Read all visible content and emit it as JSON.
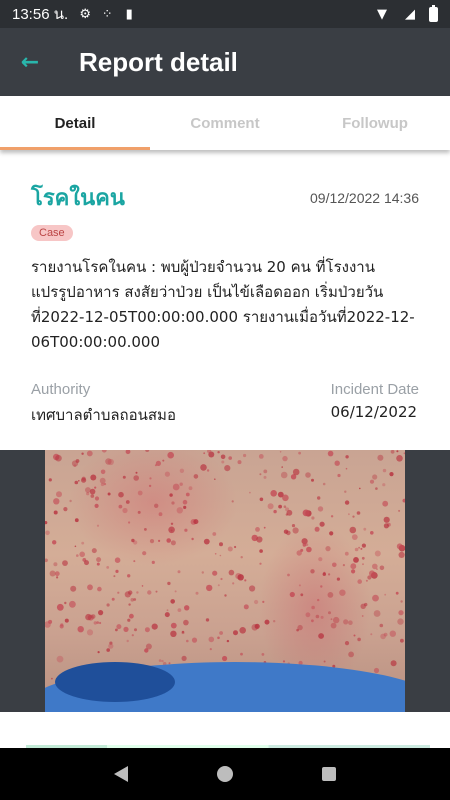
{
  "status_bar": {
    "time": "13:56 น."
  },
  "app_bar": {
    "back_icon": "arrow-left-icon",
    "title": "Report detail"
  },
  "tabs": [
    {
      "label": "Detail",
      "active": true
    },
    {
      "label": "Comment",
      "active": false
    },
    {
      "label": "Followup",
      "active": false
    }
  ],
  "report": {
    "category": "โรคในคน",
    "datetime": "09/12/2022 14:36",
    "badge": "Case",
    "description": "รายงานโรคในคน : พบผู้ป่วยจำนวน 20 คน ที่โรงงานแปรรูปอาหาร สงสัยว่าป่วย เป็นไข้เลือดออก เริ่มป่วยวันที่2022-12-05T00:00:00.000 รายงานเมื่อวันที่2022-12-06T00:00:00.000",
    "authority_label": "Authority",
    "authority_value": "เทศบาลตำบลถอนสมอ",
    "incident_label": "Incident Date",
    "incident_value": "06/12/2022"
  },
  "colors": {
    "accent": "#1aa5a2",
    "tab_indicator": "#f0a06a",
    "app_bar": "#3a3e44"
  }
}
